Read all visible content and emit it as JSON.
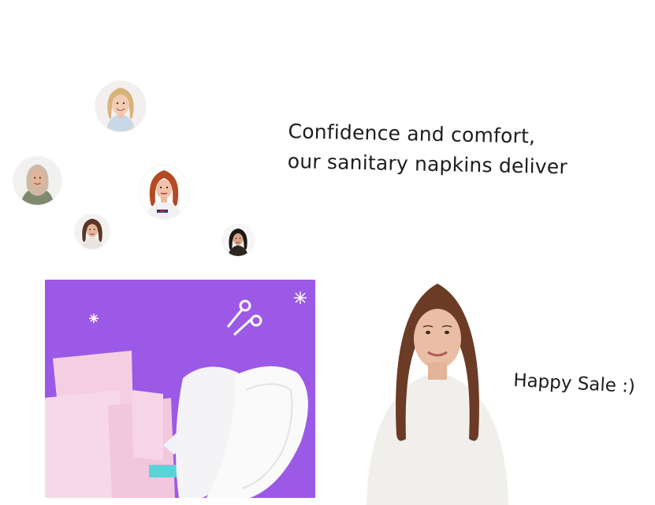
{
  "headline": {
    "line1": "Confidence and comfort,",
    "line2": "our sanitary napkins deliver"
  },
  "sale": {
    "label": "Happy Sale :)"
  },
  "colors": {
    "card_background": "#9b59e6",
    "text": "#1d1d1d",
    "pad_pink": "#f6d4e6",
    "pad_white": "#f4f4f6"
  },
  "images": {
    "avatars": [
      "blonde-woman-avatar",
      "hijab-woman-avatar",
      "redhead-woman-avatar",
      "brunette-woman-avatar",
      "dark-haired-woman-avatar"
    ],
    "card": "sanitary-pads-photo",
    "model": "smiling-woman-photo"
  }
}
